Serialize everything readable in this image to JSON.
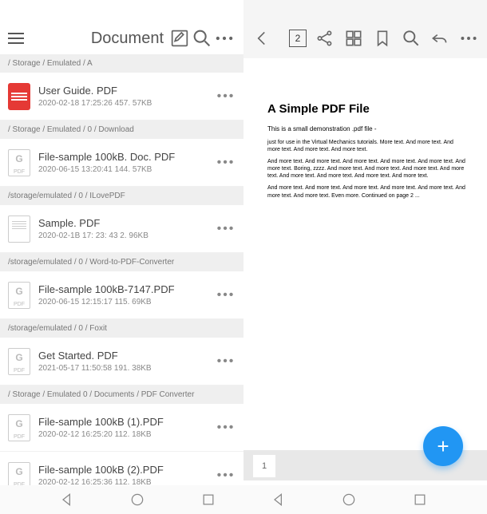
{
  "header": {
    "title": "Document"
  },
  "viewer": {
    "page_num": "2"
  },
  "sections": [
    {
      "path": "/ Storage / Emulated / A"
    },
    {
      "path": "/ Storage / Emulated / 0 / Download"
    },
    {
      "path": "/storage/emulated / 0 / ILovePDF"
    },
    {
      "path": "/storage/emulated / 0 / Word-to-PDF-Converter"
    },
    {
      "path": "/storage/emulated / 0 / Foxit"
    },
    {
      "path": "/ Storage / Emulated  0 / Documents / PDF Converter"
    }
  ],
  "files": [
    {
      "name": "User Guide. PDF",
      "meta": "2020-02-18 17:25:26 457. 57KB"
    },
    {
      "name": "File-sample  100kB. Doc. PDF",
      "meta": "2020-06-15 13:20:41 144. 57KB"
    },
    {
      "name": "Sample. PDF",
      "meta": "2020-02-1B 17: 23: 43 2. 96KB"
    },
    {
      "name": "File-sample  100kB-7147.PDF",
      "meta": "2020-06-15 12:15:17 115. 69KB"
    },
    {
      "name": "Get Started. PDF",
      "meta": "2021-05-17 11:50:58 191. 38KB"
    },
    {
      "name": "File-sample  100kB (1).PDF",
      "meta": "2020-02-12 16:25:20 112. 18KB"
    },
    {
      "name": "File-sample  100kB (2).PDF",
      "meta": "2020-02-12 16:25:36 112. 18KB"
    }
  ],
  "pdf": {
    "title": "A Simple PDF File",
    "subtitle": "This is a small demonstration .pdf file -",
    "p1": "just for use in the Virtual Mechanics tutorials. More text. And more text. And more text. And more text. And more text.",
    "p2": "And more text. And more text. And more text. And more text. And more text. And more text. Boring, zzzz. And more text. And more text. And more text. And more text. And more text. And more text. And more text. And more text.",
    "p3": "And more text. And more text. And more text. And more text. And more text. And more text. And more text. Even more. Continued on page 2 ..."
  },
  "page_tab": "1",
  "fab": "+"
}
